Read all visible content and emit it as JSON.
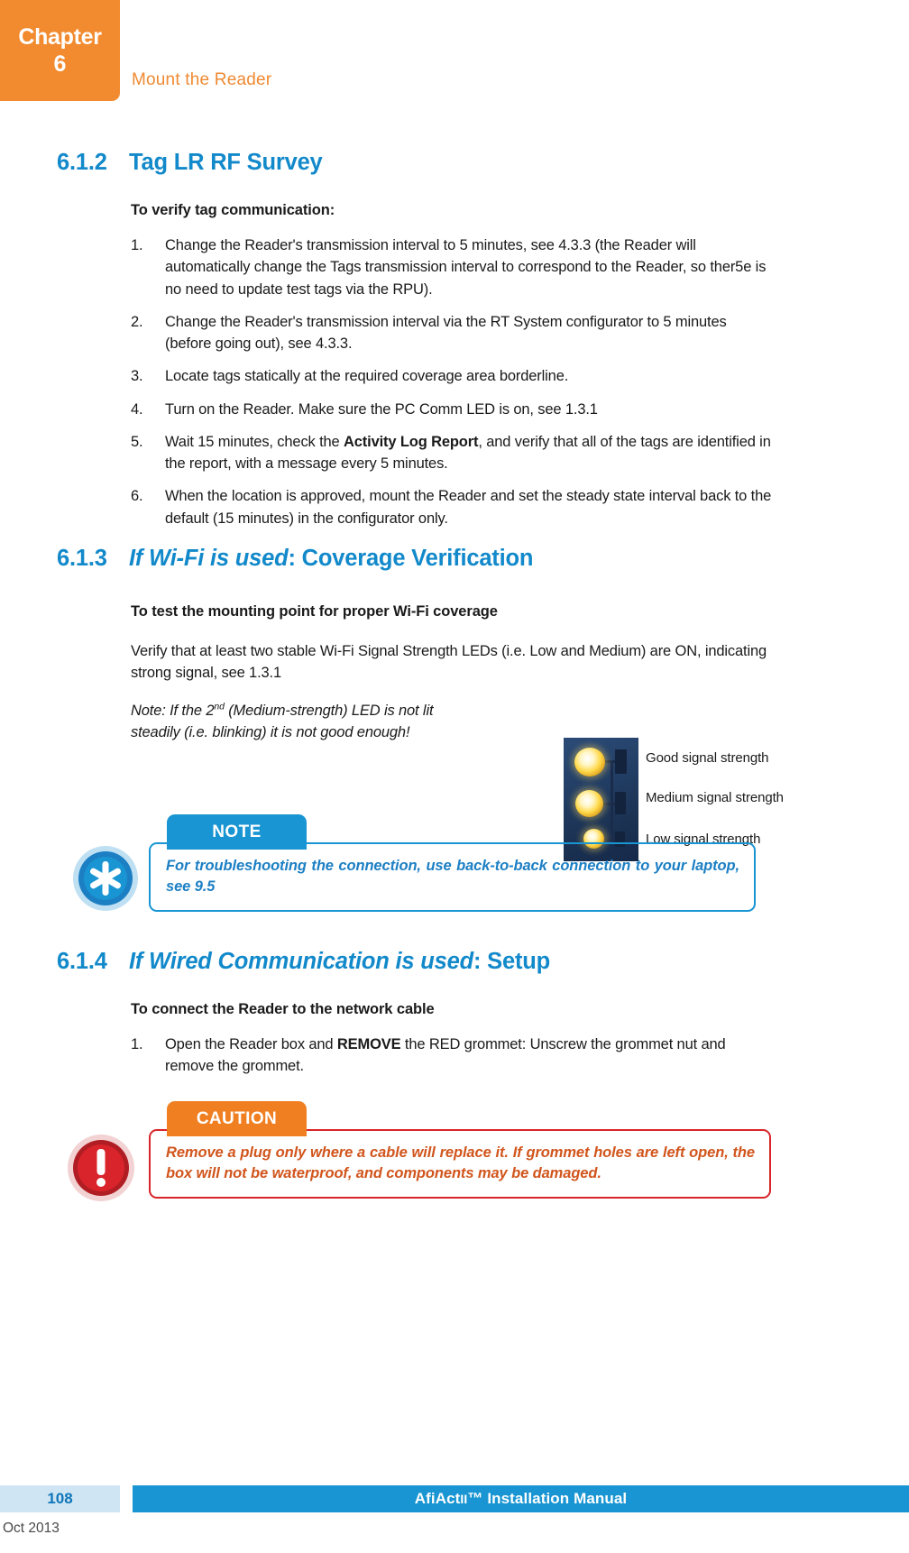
{
  "header": {
    "chapter_word": "Chapter",
    "chapter_number": "6",
    "title": "Mount the Reader"
  },
  "sections": {
    "s612": {
      "number": "6.1.2",
      "title": "Tag LR RF Survey",
      "lead": "To verify tag communication:",
      "items": [
        "Change the Reader's transmission interval to 5 minutes, see 4.3.3 (the Reader will automatically change the Tags transmission interval to correspond to the Reader, so ther5e is no need to update test tags via the RPU).",
        "Change the Reader's transmission interval via the RT System configurator to 5 minutes (before going out), see 4.3.3.",
        "Locate tags statically at the required coverage area borderline.",
        "Turn on the Reader. Make sure the PC Comm LED is on, see 1.3.1",
        "Wait 15 minutes, check the Activity Log Report, and verify that all of the tags are identified in the report, with a message every 5 minutes.",
        "When the location is approved, mount the Reader and set the steady state interval back to the default (15 minutes) in the configurator only."
      ],
      "item5_parts": {
        "before": "Wait 15 minutes, check the ",
        "bold": "Activity Log Report",
        "after": ", and verify that all of the tags are identified in the report, with a message every 5 minutes."
      },
      "markers": [
        "1.",
        "2.",
        "3.",
        "4.",
        "5.",
        "6."
      ]
    },
    "s613": {
      "number": "6.1.3",
      "title_italic": "If Wi-Fi is used",
      "title_rest": ": Coverage Verification",
      "lead": "To test the mounting point for proper Wi-Fi coverage",
      "paragraph": "Verify that at least two stable Wi-Fi Signal Strength LEDs (i.e. Low and Medium) are ON, indicating strong signal, see 1.3.1",
      "note_before": "Note: If the 2",
      "note_sup": "nd",
      "note_after": " (Medium-strength) LED is not lit steadily (i.e. blinking) it is not good enough!"
    },
    "s614": {
      "number": "6.1.4",
      "title_italic": "If Wired Communication is used",
      "title_rest": ": Setup",
      "lead": "To connect the Reader to the network cable",
      "marker": "1.",
      "item_before": "Open the Reader box and ",
      "item_bold": "REMOVE",
      "item_after": " the RED grommet: Unscrew the grommet nut and remove the grommet."
    }
  },
  "led_photo": {
    "labels": [
      "Good signal strength",
      "Medium signal strength",
      "Low signal strength"
    ]
  },
  "callouts": {
    "note": {
      "tab_label": "NOTE",
      "text": "For troubleshooting the connection, use back-to-back connection to your laptop, see 9.5",
      "icon": "asterisk-note-icon",
      "accent": "#1895D2"
    },
    "caution": {
      "tab_label": "CAUTION",
      "text": "Remove a plug only where a cable will replace it. If grommet holes are left open, the box will not be waterproof, and components may be damaged.",
      "icon": "exclamation-warning-icon",
      "tab_accent": "#F07F22",
      "border_accent": "#D8242A",
      "text_color": "#D1551C"
    }
  },
  "footer": {
    "page_number": "108",
    "manual_title_part1": "AfiAct ",
    "manual_title_part2": "II",
    "manual_title_part3": "™ Installation Manual",
    "date": "Oct 2013"
  },
  "colors": {
    "orange": "#F28B30",
    "blue": "#1289CA",
    "footer_blue": "#1895D2",
    "red": "#D8242A"
  }
}
